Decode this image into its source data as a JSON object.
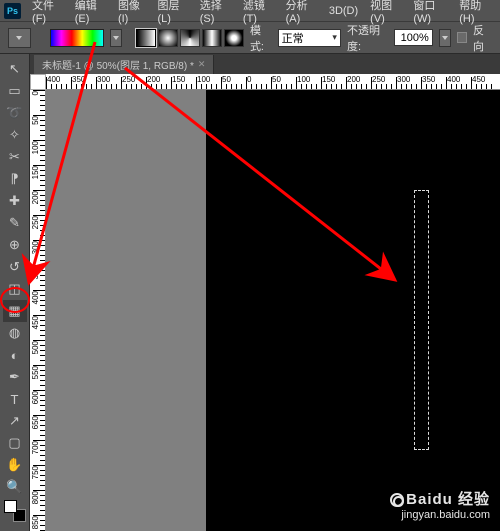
{
  "app": {
    "logo": "Ps"
  },
  "menu": {
    "file": "文件(F)",
    "edit": "编辑(E)",
    "image": "图像(I)",
    "layer": "图层(L)",
    "select": "选择(S)",
    "filter": "滤镜(T)",
    "analysis": "分析(A)",
    "3d": "3D(D)",
    "view": "视图(V)",
    "window": "窗口(W)",
    "help": "帮助(H)"
  },
  "options": {
    "mode_label": "模式:",
    "mode_value": "正常",
    "opacity_label": "不透明度:",
    "opacity_value": "100%",
    "reverse_label": "反向"
  },
  "document": {
    "tab_title": "未标题-1 @ 50%(图层 1, RGB/8) *"
  },
  "ruler": {
    "h_labels": [
      "400",
      "350",
      "300",
      "250",
      "200",
      "150",
      "100",
      "50",
      "0",
      "50",
      "100",
      "150",
      "200",
      "250",
      "300",
      "350",
      "400",
      "450"
    ],
    "v_labels": [
      "0",
      "50",
      "100",
      "150",
      "200",
      "250",
      "300",
      "350",
      "400",
      "450",
      "500",
      "550",
      "600",
      "650",
      "700",
      "750",
      "800",
      "850"
    ]
  },
  "tools": {
    "move": "↖",
    "marquee": "▭",
    "lasso": "➰",
    "wand": "✧",
    "crop": "✂",
    "eyedropper": "⁋",
    "patch": "✚",
    "brush": "✎",
    "stamp": "⊕",
    "history": "↺",
    "eraser": "◫",
    "gradient": "▦",
    "blur": "◍",
    "dodge": "◐",
    "pen": "✒",
    "type": "T",
    "path": "↗",
    "shape": "▢",
    "hand": "✋",
    "zoom": "🔍"
  },
  "watermark": {
    "brand": "Baidu 经验",
    "url": "jingyan.baidu.com"
  }
}
